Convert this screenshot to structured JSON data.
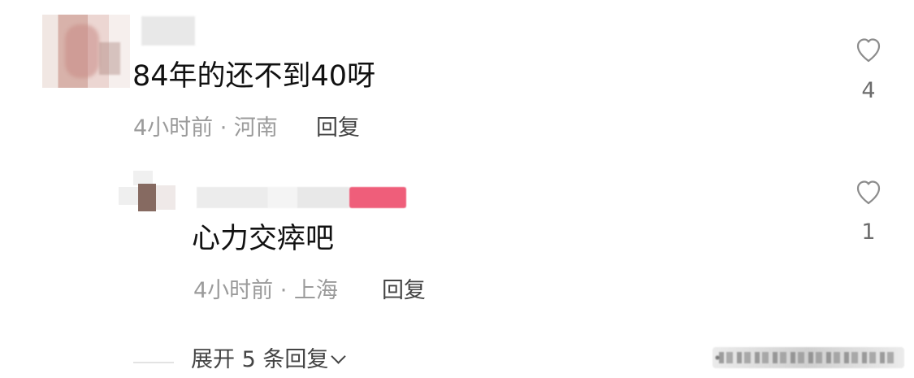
{
  "comment": {
    "text": "84年的还不到40呀",
    "meta": "4小时前 · 河南",
    "reply_label": "回复",
    "like_count": "4"
  },
  "reply": {
    "text": "心力交瘁吧",
    "meta": "4小时前 · 上海",
    "reply_label": "回复",
    "like_count": "1"
  },
  "expand": {
    "label": "展开 5 条回复"
  },
  "icons": {
    "heart": "heart-outline-icon",
    "chevron": "chevron-down-icon"
  },
  "colors": {
    "primary_text": "#111111",
    "secondary_text": "#9b9b9b",
    "action_text": "#444444",
    "accent_badge": "#ef5e7a"
  }
}
